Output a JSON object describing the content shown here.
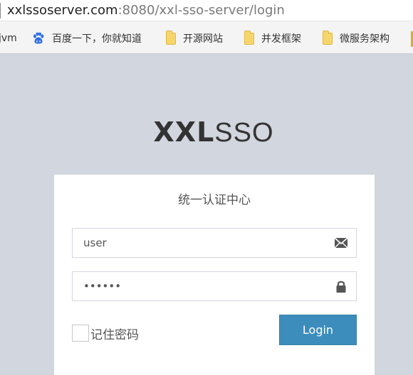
{
  "browser": {
    "address_host": "xxlssoserver.com",
    "address_path": ":8080/xxl-sso-server/login",
    "bookmarks": [
      {
        "label": "jvm",
        "icon": "none"
      },
      {
        "label": "百度一下，你就知道",
        "icon": "baidu-paw-icon"
      },
      {
        "label": "开源网站",
        "icon": "folder-icon"
      },
      {
        "label": "并发框架",
        "icon": "folder-icon"
      },
      {
        "label": "微服务架构",
        "icon": "folder-icon"
      }
    ]
  },
  "login": {
    "logo_bold": "XXL",
    "logo_light": "SSO",
    "box_message": "统一认证中心",
    "username_value": "user",
    "password_value": "123456",
    "username_icon": "envelope-icon",
    "password_icon": "lock-icon",
    "remember_label": "记住密码",
    "remember_checked": false,
    "login_button_label": "Login"
  },
  "colors": {
    "page_background": "#d2d6de",
    "button_primary": "#3c8dbc",
    "box_background": "#ffffff",
    "baidu_blue": "#2f6fe4",
    "folder_yellow": "#f6d66c"
  }
}
